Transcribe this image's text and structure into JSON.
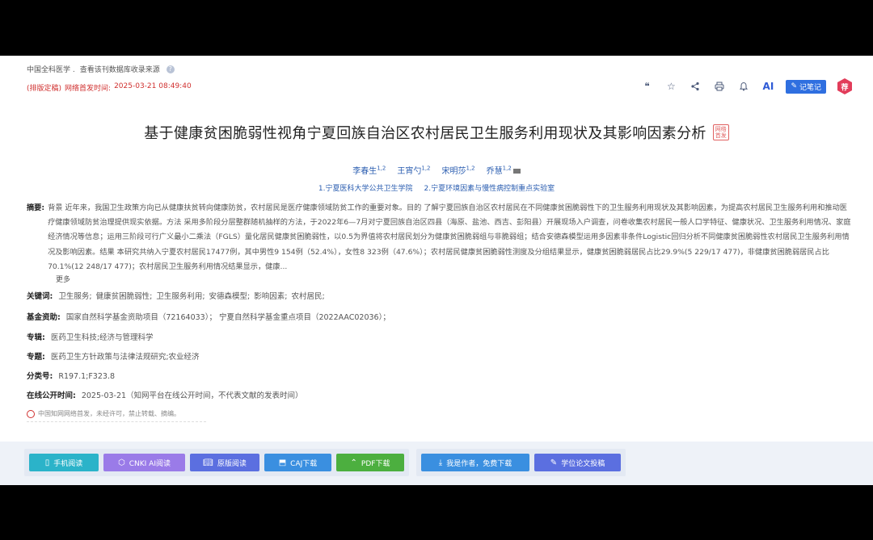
{
  "header": {
    "journal": "中国全科医学 .",
    "lookup": "查看该刊数据库收录来源",
    "pub_status": "(排版定稿)",
    "pub_time_label": "网络首发时间:",
    "pub_time": "2025-03-21 08:49:40"
  },
  "toolbar": {
    "ai": "AI",
    "note": "记笔记",
    "hex": "荐"
  },
  "article": {
    "title": "基于健康贫困脆弱性视角宁夏回族自治区农村居民卫生服务利用现状及其影响因素分析",
    "badge": "网络首发",
    "authors": [
      {
        "name": "李春生",
        "sup": "1,2"
      },
      {
        "name": "王宵勺",
        "sup": "1,2"
      },
      {
        "name": "宋明莎",
        "sup": "1,2"
      },
      {
        "name": "乔慧",
        "sup": "1,2"
      }
    ],
    "affiliations": [
      "1.宁夏医科大学公共卫生学院",
      "2.宁夏环境因素与慢性病控制重点实验室"
    ],
    "abstract_label": "摘要:",
    "abstract": "背景 近年来，我国卫生政策方向已从健康扶贫转向健康防贫，农村居民是医疗健康领域防贫工作的重要对象。目的 了解宁夏回族自治区农村居民在不同健康贫困脆弱性下的卫生服务利用现状及其影响因素，为提高农村居民卫生服务利用和推动医疗健康领域防贫治理提供现实依据。方法 采用多阶段分层整群随机抽样的方法，于2022年6—7月对宁夏回族自治区四县（海原、盐池、西吉、彭阳县）开展现场入户调查，问卷收集农村居民一般人口学特征、健康状况、卫生服务利用情况、家庭经济情况等信息；运用三阶段可行广义最小二乘法（FGLS）量化居民健康贫困脆弱性，以0.5为界值将农村居民划分为健康贫困脆弱组与非脆弱组；结合安德森模型运用多因素非条件Logistic回归分析不同健康贫困脆弱性农村居民卫生服务利用情况及影响因素。结果 本研究共纳入宁夏农村居民17477例，其中男性9 154例（52.4%），女性8 323例（47.6%）；农村居民健康贫困脆弱性测度及分组结果显示，健康贫困脆弱居民占比29.9%(5 229/17 477)，非健康贫困脆弱居民占比70.1%(12 248/17 477)；农村居民卫生服务利用情况结果显示，健康...",
    "more": "更多",
    "keywords_label": "关键词:",
    "keywords": [
      "卫生服务;",
      "健康贫困脆弱性;",
      "卫生服务利用;",
      "安德森模型;",
      "影响因素;",
      "农村居民;"
    ],
    "fund_label": "基金资助:",
    "fund": "国家自然科学基金资助项目（72164033）；  宁夏自然科学基金重点项目（2022AAC02036）；",
    "series_label": "专辑:",
    "series": "医药卫生科技;经济与管理科学",
    "topic_label": "专题:",
    "topic": "医药卫生方针政策与法律法规研究;农业经济",
    "class_label": "分类号:",
    "class": "R197.1;F323.8",
    "online_label": "在线公开时间:",
    "online": "2025-03-21（知网平台在线公开时间，不代表文献的发表时间）",
    "copyright": "中国知网网络首发，未经许可，禁止转载、摘编。"
  },
  "actions": {
    "mobile": "手机阅读",
    "cnki_ai": "CNKI AI阅读",
    "original": "原版阅读",
    "caj": "CAJ下载",
    "pdf": "PDF下载",
    "author_dl": "我是作者，免费下载",
    "submit": "学位论文投稿"
  },
  "colors": {
    "mobile": "#2bb3c9",
    "cnki_ai": "#9a7be8",
    "original": "#5b6fe0",
    "caj": "#3a8fe0",
    "pdf": "#4caf3f",
    "author_dl": "#3a8fe0",
    "submit": "#5b6fe0"
  }
}
